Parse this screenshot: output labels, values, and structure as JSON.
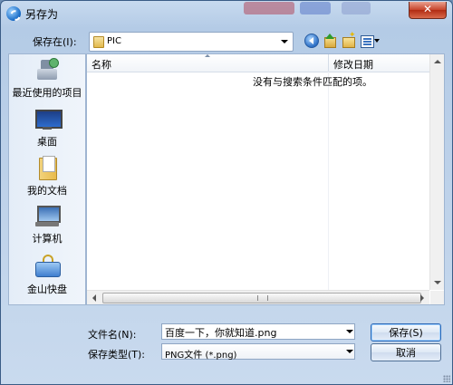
{
  "window": {
    "title": "另存为"
  },
  "toolbar": {
    "save_in_label": "保存在(I):",
    "current_folder": "PIC",
    "back_icon": "back-arrow-icon",
    "up_icon": "up-folder-icon",
    "new_folder_icon": "new-folder-icon",
    "view_icon": "view-menu-icon"
  },
  "places": [
    {
      "label": "最近使用的项目",
      "icon": "recent-items-icon"
    },
    {
      "label": "桌面",
      "icon": "desktop-icon"
    },
    {
      "label": "我的文档",
      "icon": "my-documents-icon"
    },
    {
      "label": "计算机",
      "icon": "computer-icon"
    },
    {
      "label": "金山快盘",
      "icon": "kuaipan-icon"
    }
  ],
  "file_list": {
    "columns": [
      "名称",
      "修改日期"
    ],
    "empty_message": "没有与搜索条件匹配的项。"
  },
  "form": {
    "filename_label": "文件名(N):",
    "filename_value": "百度一下，你就知道.png",
    "filetype_label": "保存类型(T):",
    "filetype_value": "PNG文件 (*.png)"
  },
  "buttons": {
    "save": "保存(S)",
    "cancel": "取消"
  },
  "colors": {
    "accent": "#2a67b5",
    "close": "#c7432a"
  }
}
